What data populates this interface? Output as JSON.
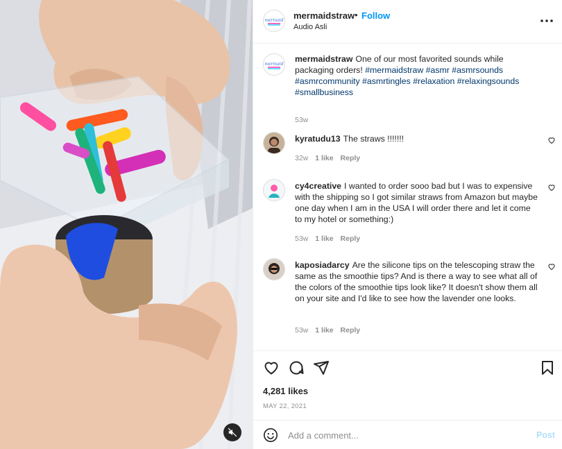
{
  "colors": {
    "accent": "#0095f6",
    "link": "#00376b",
    "muted": "#8e8e8e",
    "text": "#262626",
    "post_disabled": "#b2dffc"
  },
  "media": {
    "mute_icon": "speaker-muted-icon"
  },
  "header": {
    "username": "mermaidstraw",
    "separator": "•",
    "follow_label": "Follow",
    "audio_label": "Audio Asli",
    "more_icon": "more-horizontal-icon"
  },
  "caption": {
    "username": "mermaidstraw",
    "text": "One of our most favorited sounds while packaging orders!",
    "hashtags": [
      "#mermaidstraw",
      "#asmr",
      "#asmrsounds",
      "#asmrcommunity",
      "#asmrtingles",
      "#relaxation",
      "#relaxingsounds",
      "#smallbusiness"
    ],
    "time": "53w"
  },
  "comments": [
    {
      "username": "kyratudu13",
      "text": "The straws !!!!!!!",
      "time": "32w",
      "likes": "1 like",
      "reply": "Reply"
    },
    {
      "username": "cy4creative",
      "text": "I wanted to order sooo bad but I was to expensive with the shipping so I got similar straws from Amazon but maybe one day when I am in the USA I will order there and let it come to my hotel or something:)",
      "time": "53w",
      "likes": "1 like",
      "reply": "Reply"
    },
    {
      "username": "kaposiadarcy",
      "text": "Are the silicone tips on the telescoping straw the same as the smoothie tips? And is there a way to see what all of the colors of the smoothie tips look like? It doesn't show them all on your site and I'd like to see how the lavender one looks.",
      "time": "53w",
      "likes": "1 like",
      "reply": "Reply"
    }
  ],
  "actions": {
    "icons": [
      "heart-icon",
      "comment-icon",
      "share-icon",
      "bookmark-icon"
    ],
    "likes": "4,281 likes",
    "date": "MAY 22, 2021"
  },
  "add_comment": {
    "placeholder": "Add a comment...",
    "post_label": "Post",
    "emoji_icon": "emoji-icon"
  }
}
